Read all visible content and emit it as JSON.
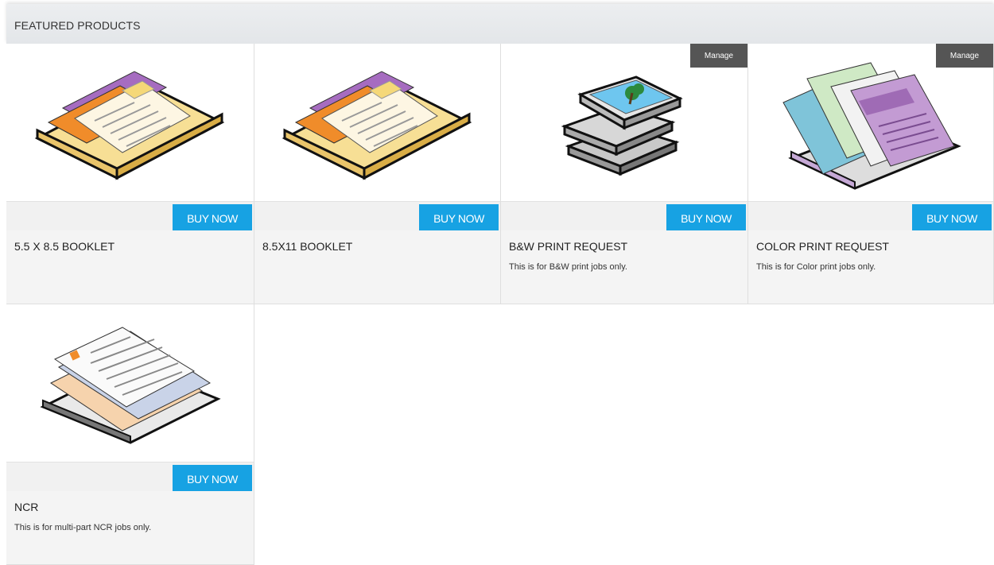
{
  "panel": {
    "title": "FEATURED PRODUCTS"
  },
  "products": [
    {
      "name": "5.5 X 8.5 BOOKLET",
      "description": "",
      "buy_label": "BUY NOW",
      "icon": "booklet-icon"
    },
    {
      "name": "8.5X11 BOOKLET",
      "description": "",
      "buy_label": "BUY NOW",
      "icon": "booklet-icon"
    },
    {
      "name": "B&W PRINT REQUEST",
      "description": "This is for B&W print jobs only.",
      "buy_label": "BUY NOW",
      "manage_label": "Manage",
      "icon": "photo-stack-icon"
    },
    {
      "name": "COLOR PRINT REQUEST",
      "description": "This is for Color print jobs only.",
      "buy_label": "BUY NOW",
      "manage_label": "Manage",
      "icon": "color-documents-icon"
    },
    {
      "name": "NCR",
      "description": "This is for multi-part NCR jobs only.",
      "buy_label": "BUY NOW",
      "icon": "ncr-forms-icon"
    }
  ],
  "colors": {
    "buy_button": "#17a2e3",
    "manage_button": "#555555",
    "header_bg": "#e6e9ec"
  }
}
